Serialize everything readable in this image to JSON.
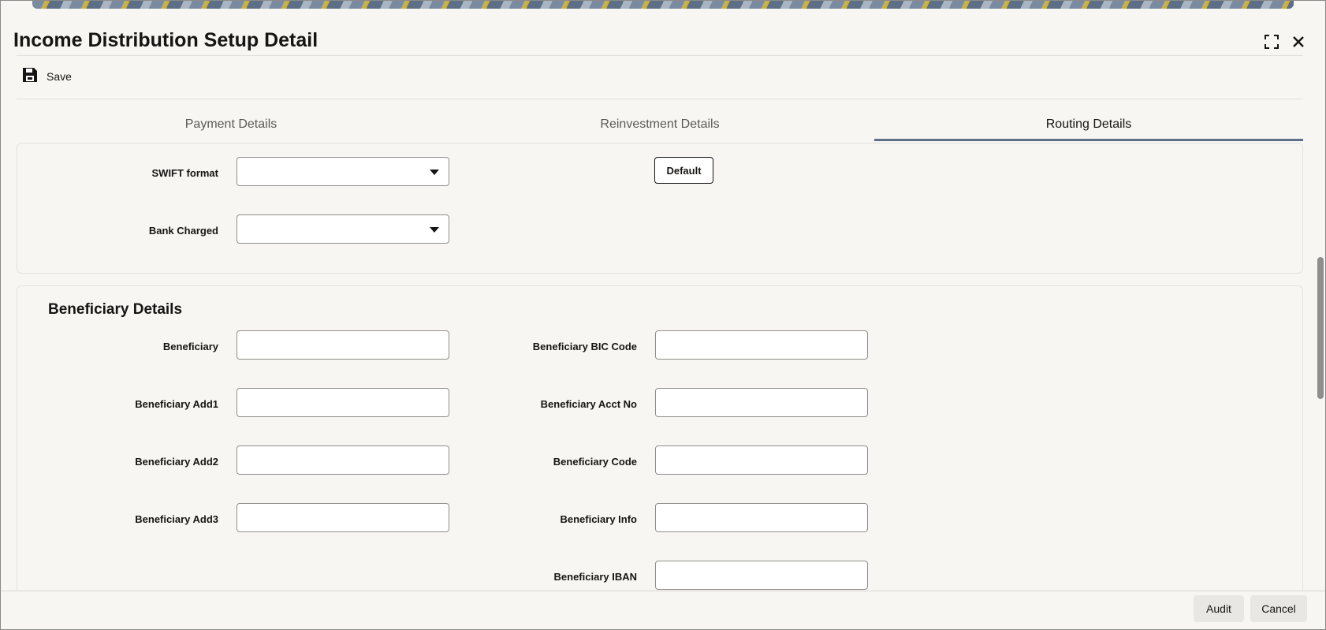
{
  "window": {
    "title": "Income Distribution Setup Detail"
  },
  "toolbar": {
    "save_label": "Save"
  },
  "tabs": [
    {
      "label": "Payment Details",
      "active": false
    },
    {
      "label": "Reinvestment Details",
      "active": false
    },
    {
      "label": "Routing Details",
      "active": true
    }
  ],
  "routing": {
    "swift_format_label": "SWIFT format",
    "swift_format_value": "",
    "bank_charged_label": "Bank Charged",
    "bank_charged_value": "",
    "default_button": "Default"
  },
  "beneficiary": {
    "section_title": "Beneficiary Details",
    "fields_left": [
      {
        "label": "Beneficiary",
        "value": ""
      },
      {
        "label": "Beneficiary Add1",
        "value": ""
      },
      {
        "label": "Beneficiary Add2",
        "value": ""
      },
      {
        "label": "Beneficiary Add3",
        "value": ""
      }
    ],
    "fields_right": [
      {
        "label": "Beneficiary BIC Code",
        "value": ""
      },
      {
        "label": "Beneficiary Acct No",
        "value": ""
      },
      {
        "label": "Beneficiary Code",
        "value": ""
      },
      {
        "label": "Beneficiary Info",
        "value": ""
      },
      {
        "label": "Beneficiary IBAN",
        "value": ""
      }
    ]
  },
  "footer": {
    "audit_label": "Audit",
    "cancel_label": "Cancel"
  },
  "icons": {
    "save": "floppy-disk-icon",
    "maximize": "maximize-icon",
    "close": "close-icon",
    "dropdown": "caret-down-icon"
  },
  "colors": {
    "accent": "#5e6f8a",
    "background": "#f7f6f3",
    "text": "#161513"
  }
}
